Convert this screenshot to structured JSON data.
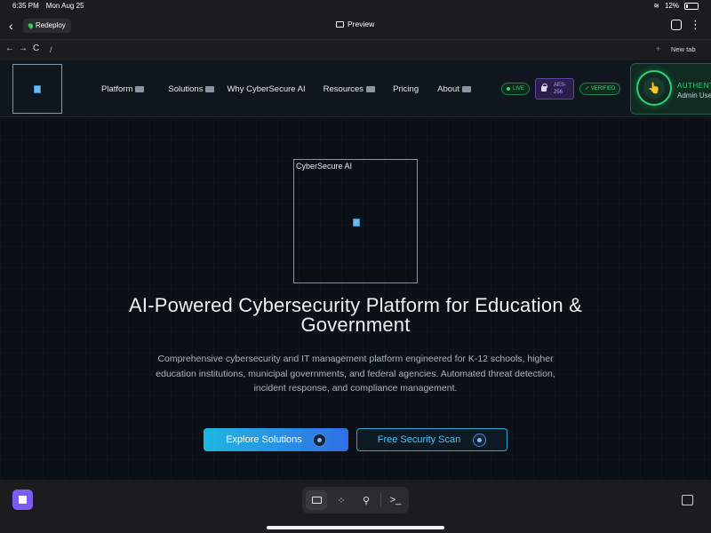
{
  "status": {
    "time": "6:35 PM",
    "date": "Mon Aug 25",
    "battery": "12%"
  },
  "app": {
    "back": "‹",
    "redeploy_label": "Redeploy",
    "preview_label": "Preview",
    "more": "⋮"
  },
  "browser": {
    "back": "←",
    "forward": "→",
    "reload": "C",
    "url": "/",
    "plus": "+",
    "new_tab": "New tab"
  },
  "nav": {
    "links": [
      "Platform",
      "Solutions",
      "Why CyberSecure AI",
      "Resources",
      "Pricing",
      "About"
    ],
    "badge_live": "LIVE",
    "badge_aes": "AES-256",
    "badge_verified": "VERIFIED",
    "auth_title": "AUTHENTICATED",
    "auth_sub": "Admin User",
    "auth_icon": "👆"
  },
  "hero": {
    "image_alt": "CyberSecure AI",
    "title": "AI-Powered Cybersecurity Platform for Education & Government",
    "description": "Comprehensive cybersecurity and IT management platform engineered for K-12 schools, higher education institutions, municipal governments, and federal agencies. Automated threat detection, incident response, and compliance management.",
    "primary_cta": "Explore Solutions",
    "secondary_cta": "Free Security Scan"
  },
  "dock": {
    "terminal": ">_"
  },
  "colors": {
    "accent": "#2ed27a",
    "primary_gradient_start": "#1fb7e0",
    "primary_gradient_end": "#2f6fe8",
    "dock_app": "#7b5cf0"
  }
}
